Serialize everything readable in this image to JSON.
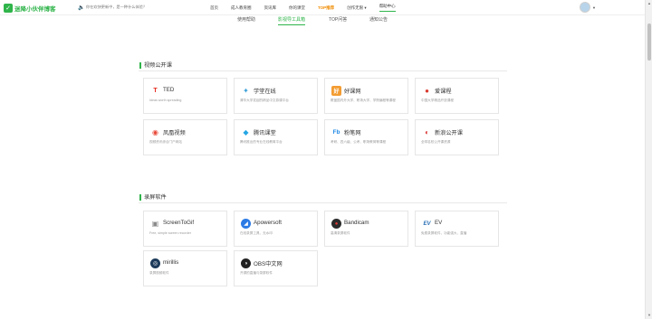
{
  "header": {
    "logo_text": "迷降小伙伴博客",
    "ticker": "你在欢快更新中，是一种什么体验？",
    "nav": [
      {
        "label": "首页"
      },
      {
        "label": "成人教育圈"
      },
      {
        "label": "资讯库"
      },
      {
        "label": "你的课堂"
      },
      {
        "label": "TOP推荐"
      },
      {
        "label": "创作无限 ▾"
      },
      {
        "label": "帮助中心"
      }
    ]
  },
  "subnav": [
    {
      "label": "使用帮助"
    },
    {
      "label": "影视导工具箱"
    },
    {
      "label": "TOP问答"
    },
    {
      "label": "通知公告"
    }
  ],
  "sections": [
    {
      "title": "视频公开课",
      "cards": [
        {
          "name": "TED",
          "desc": "Ideas worth spreading",
          "icon": "ted-logo-icon",
          "color": "#e62b1e",
          "glyph": "T"
        },
        {
          "name": "学堂在线",
          "desc": "清华大学发起的精品中文慕课平台",
          "icon": "xuetang-logo-icon",
          "color": "#3aa0d8",
          "glyph": "✦"
        },
        {
          "name": "好课网",
          "desc": "覆盖国内外大学、职场大学、学院编程等课程",
          "icon": "haoke-logo-icon",
          "color": "#f39c32",
          "glyph": "好"
        },
        {
          "name": "爱课程",
          "desc": "中国大学精品开放课程",
          "icon": "aikecheng-logo-icon",
          "color": "#d93a2f",
          "glyph": "●"
        },
        {
          "name": "凤凰视频",
          "desc": "视频资讯综合门户网站",
          "icon": "phoenix-logo-icon",
          "color": "#e84b3c",
          "glyph": "◉"
        },
        {
          "name": "腾讯课堂",
          "desc": "腾讯推出的专业在线教育平台",
          "icon": "tencent-class-logo-icon",
          "color": "#26a6e4",
          "glyph": "◆"
        },
        {
          "name": "粉笔网",
          "desc": "考研、四六级、公考、职场教育等课程",
          "icon": "fenbi-logo-icon",
          "color": "#1f88e5",
          "glyph": "Fb"
        },
        {
          "name": "新浪公开课",
          "desc": "全球名校公开课资源",
          "icon": "sina-logo-icon",
          "color": "#d8302f",
          "glyph": "◐"
        }
      ]
    },
    {
      "title": "录屏软件",
      "cards": [
        {
          "name": "ScreenToGif",
          "desc": "Free, simple screen recorder",
          "icon": "screentogif-logo-icon",
          "color": "#8a8a8a",
          "glyph": "▣"
        },
        {
          "name": "Apowersoft",
          "desc": "在线录屏工具，无水印",
          "icon": "apowersoft-logo-icon",
          "color": "#2c7be5",
          "glyph": "◢"
        },
        {
          "name": "Bandicam",
          "desc": "高清录屏软件",
          "icon": "bandicam-logo-icon",
          "color": "#2b2b2b",
          "glyph": "●"
        },
        {
          "name": "EV",
          "desc": "免费录屏软件，功能强大，直播",
          "icon": "ev-logo-icon",
          "color": "#2a6fb5",
          "glyph": "EV"
        },
        {
          "name": "mirillis",
          "desc": "录屏视频软件",
          "icon": "mirillis-logo-icon",
          "color": "#1d3a5a",
          "glyph": "◎"
        },
        {
          "name": "OBS中文网",
          "desc": "开源的直播与录屏软件",
          "icon": "obs-logo-icon",
          "color": "#222222",
          "glyph": "◑"
        }
      ]
    }
  ]
}
